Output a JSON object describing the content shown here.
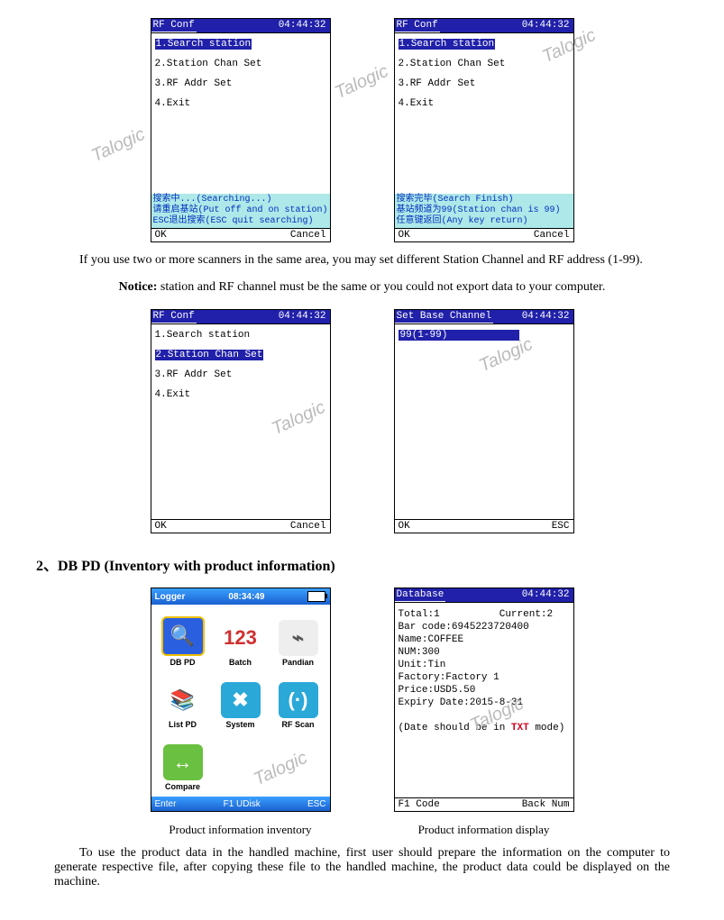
{
  "watermark": "Talogic",
  "row1": {
    "screenA": {
      "title": "RF Conf",
      "time": "04:44:32",
      "items": [
        "1.Search station",
        "2.Station Chan Set",
        "3.RF Addr Set",
        "4.Exit"
      ],
      "selectedIndex": 0,
      "status": "搜索中...(Searching...)\n请重启基站(Put off and on station)\nESC退出搜索(ESC quit searching)",
      "footL": "OK",
      "footR": "Cancel"
    },
    "screenB": {
      "title": "RF Conf",
      "time": "04:44:32",
      "items": [
        "1.Search station",
        "2.Station Chan Set",
        "3.RF Addr Set",
        "4.Exit"
      ],
      "selectedIndex": 0,
      "status": "搜索完毕(Search Finish)\n基站频道为99(Station chan is 99)\n任意键返回(Any key return)",
      "footL": "OK",
      "footR": "Cancel"
    }
  },
  "para1": "If   you use two or more scanners in the same area, you may set different Station Channel and RF address (1-99).",
  "noticeLabel": "Notice:",
  "noticeText": " station and RF channel must be the same or you could not export data to your computer.",
  "row2": {
    "screenA": {
      "title": "RF Conf",
      "time": "04:44:32",
      "items": [
        "1.Search station",
        "2.Station Chan Set",
        "3.RF Addr Set",
        "4.Exit"
      ],
      "selectedIndex": 1,
      "footL": "OK",
      "footR": "Cancel"
    },
    "screenB": {
      "title": "Set Base Channel",
      "time": "04:44:32",
      "input": "99(1-99)",
      "footL": "OK",
      "footR": "ESC"
    }
  },
  "sectionHeading": "2、DB PD (Inventory with product information)",
  "row3": {
    "logger": {
      "title": "Logger",
      "time": "08:34:49",
      "apps": [
        {
          "label": "DB PD",
          "color": "#2a60e0",
          "glyph": "🔍"
        },
        {
          "label": "Batch",
          "color": "#ffffff",
          "glyph": "123",
          "textcolor": "#d03030"
        },
        {
          "label": "Pandian",
          "color": "#eeeeee",
          "glyph": "⌁",
          "textcolor": "#555"
        },
        {
          "label": "List PD",
          "color": "#ffffff",
          "glyph": "📚"
        },
        {
          "label": "System",
          "color": "#2aa8d8",
          "glyph": "✖"
        },
        {
          "label": "RF Scan",
          "color": "#2aa8d8",
          "glyph": "(·)"
        },
        {
          "label": "Compare",
          "color": "#6ac040",
          "glyph": "↔"
        }
      ],
      "footL": "Enter",
      "footM": "F1 UDisk",
      "footR": "ESC"
    },
    "db": {
      "title": "Database",
      "time": "04:44:32",
      "lines": [
        "Total:1          Current:2",
        "Bar code:6945223720400",
        "Name:COFFEE",
        "NUM:300",
        "Unit:Tin",
        "Factory:Factory 1",
        "Price:USD5.50",
        "Expiry Date:2015-8-31",
        "",
        "(Date should be in TXT mode)"
      ],
      "footL": "F1 Code",
      "footR": "Back Num"
    }
  },
  "caption1": "Product information inventory",
  "caption2": "Product information display",
  "para2": "To use the product data in the handled machine, first user should prepare the information on the computer to generate respective file, after copying these file to the handled machine, the product data could be displayed on the machine."
}
